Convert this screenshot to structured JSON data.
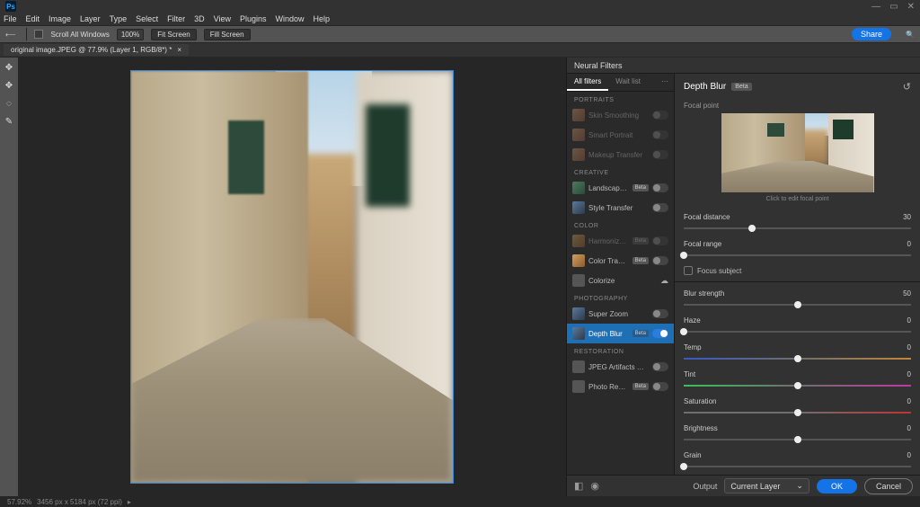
{
  "menu": {
    "items": [
      "File",
      "Edit",
      "Image",
      "Layer",
      "Type",
      "Select",
      "Filter",
      "3D",
      "View",
      "Plugins",
      "Window",
      "Help"
    ]
  },
  "windowControls": {
    "min": "—",
    "max": "▭",
    "close": "✕"
  },
  "options": {
    "scroll_all": "Scroll All Windows",
    "zoom": "100%",
    "fit": "Fit Screen",
    "fill": "Fill Screen",
    "share": "Share"
  },
  "docTab": {
    "title": "original image.JPEG @ 77.9% (Layer 1, RGB/8*) *",
    "close": "×"
  },
  "tools": {
    "t1": "✥",
    "t2": "✥",
    "t3": "◌",
    "t4": "✎"
  },
  "nf": {
    "header": "Neural Filters",
    "tabs": {
      "all": "All filters",
      "wait": "Wait list"
    },
    "cats": {
      "portraits": "PORTRAITS",
      "creative": "CREATIVE",
      "color": "COLOR",
      "photography": "PHOTOGRAPHY",
      "restoration": "RESTORATION"
    },
    "items": {
      "skin": "Skin Smoothing",
      "smart": "Smart Portrait",
      "makeup": "Makeup Transfer",
      "landscape": "Landscape Mixer",
      "style": "Style Transfer",
      "harm": "Harmonization",
      "colortransfer": "Color Transfer",
      "colorize": "Colorize",
      "superzoom": "Super Zoom",
      "depth": "Depth Blur",
      "jpeg": "JPEG Artifacts Removal",
      "photo": "Photo Restoration"
    },
    "beta": "Beta",
    "title": "Depth Blur",
    "focal_point": "Focal point",
    "preview_caption": "Click to edit focal point",
    "sliders": {
      "focal_distance": {
        "label": "Focal distance",
        "value": "30",
        "pos": 30
      },
      "focal_range": {
        "label": "Focal range",
        "value": "0",
        "pos": 0
      },
      "focus_subject": "Focus subject",
      "blur_strength": {
        "label": "Blur strength",
        "value": "50",
        "pos": 50
      },
      "haze": {
        "label": "Haze",
        "value": "0",
        "pos": 0
      },
      "temp": {
        "label": "Temp",
        "value": "0",
        "pos": 50
      },
      "tint": {
        "label": "Tint",
        "value": "0",
        "pos": 50
      },
      "saturation": {
        "label": "Saturation",
        "value": "0",
        "pos": 50
      },
      "brightness": {
        "label": "Brightness",
        "value": "0",
        "pos": 50
      },
      "grain": {
        "label": "Grain",
        "value": "0",
        "pos": 0
      }
    },
    "output": {
      "label": "Output",
      "value": "Current Layer"
    },
    "ok": "OK",
    "cancel": "Cancel"
  },
  "status": {
    "zoom": "57.92%",
    "docinfo": "3456 px x 5184 px (72 ppi)"
  }
}
